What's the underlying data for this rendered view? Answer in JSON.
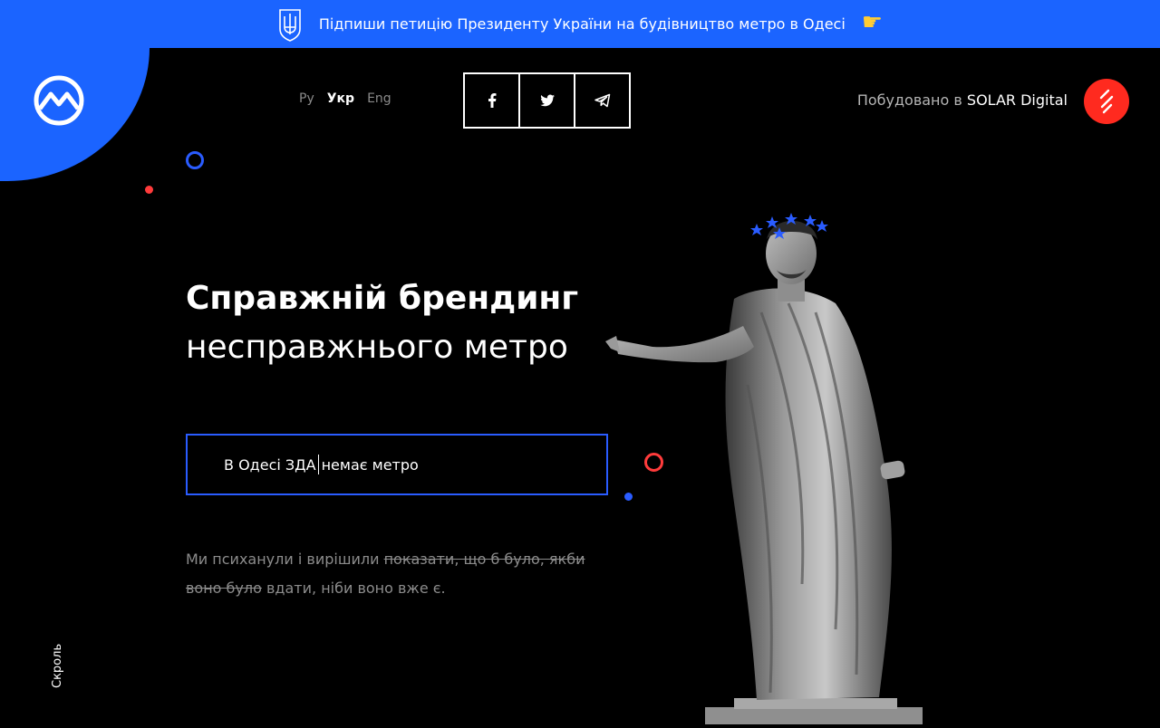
{
  "banner": {
    "text": "Підпиши петицію Президенту України на будівництво метро в Одесі"
  },
  "language": {
    "ru": "Ру",
    "uk": "Укр",
    "en": "Eng"
  },
  "built_by": {
    "prefix": "Побудовано в",
    "brand": "SOLAR Digital"
  },
  "hero": {
    "title_line1": "Справжній брендинг",
    "title_line2": "несправжнього метро"
  },
  "claim": {
    "before_caret": "В Одесі ЗДА",
    "after_caret": "немає метро"
  },
  "description": {
    "part1": "Ми психанули і вирішили",
    "strikethrough": "показати, що б було, якби воно було",
    "part2": "вдати, ніби воно вже є."
  },
  "scroll": {
    "label": "Скроль"
  },
  "colors": {
    "accent_blue": "#1b64ff",
    "accent_red": "#ff2a1f",
    "background": "#000000"
  }
}
